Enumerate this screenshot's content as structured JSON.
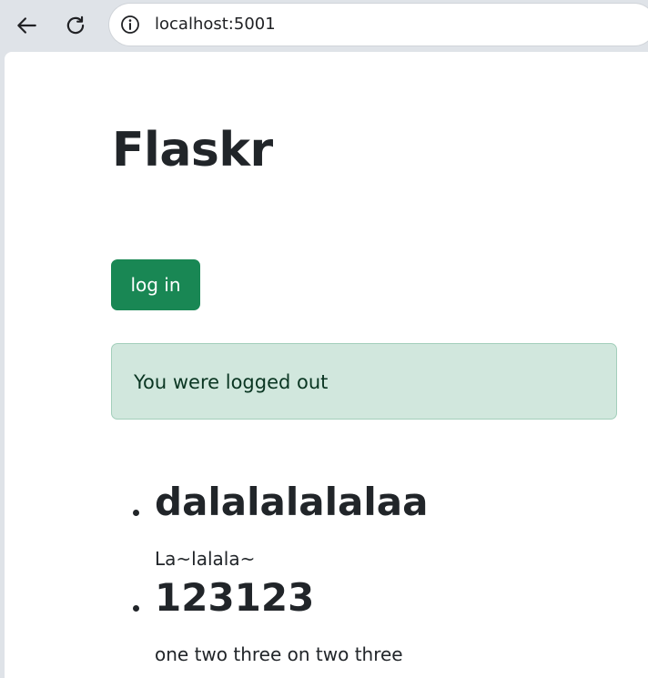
{
  "browser": {
    "url": "localhost:5001",
    "back_icon": "arrow-left-icon",
    "reload_icon": "reload-icon",
    "info_icon": "info-icon"
  },
  "page": {
    "title": "Flaskr",
    "login_label": "log in",
    "flash_message": "You were logged out"
  },
  "entries": [
    {
      "title": "dalalalalalaa",
      "text": "La~lalala~"
    },
    {
      "title": "123123",
      "text": "one two three on two three"
    }
  ],
  "colors": {
    "button_bg": "#198754",
    "alert_bg": "#d1e7dd",
    "alert_border": "#a3cfbb",
    "alert_text": "#0a3622",
    "body_text": "#212529",
    "chrome_bg": "#dfe3e8"
  }
}
